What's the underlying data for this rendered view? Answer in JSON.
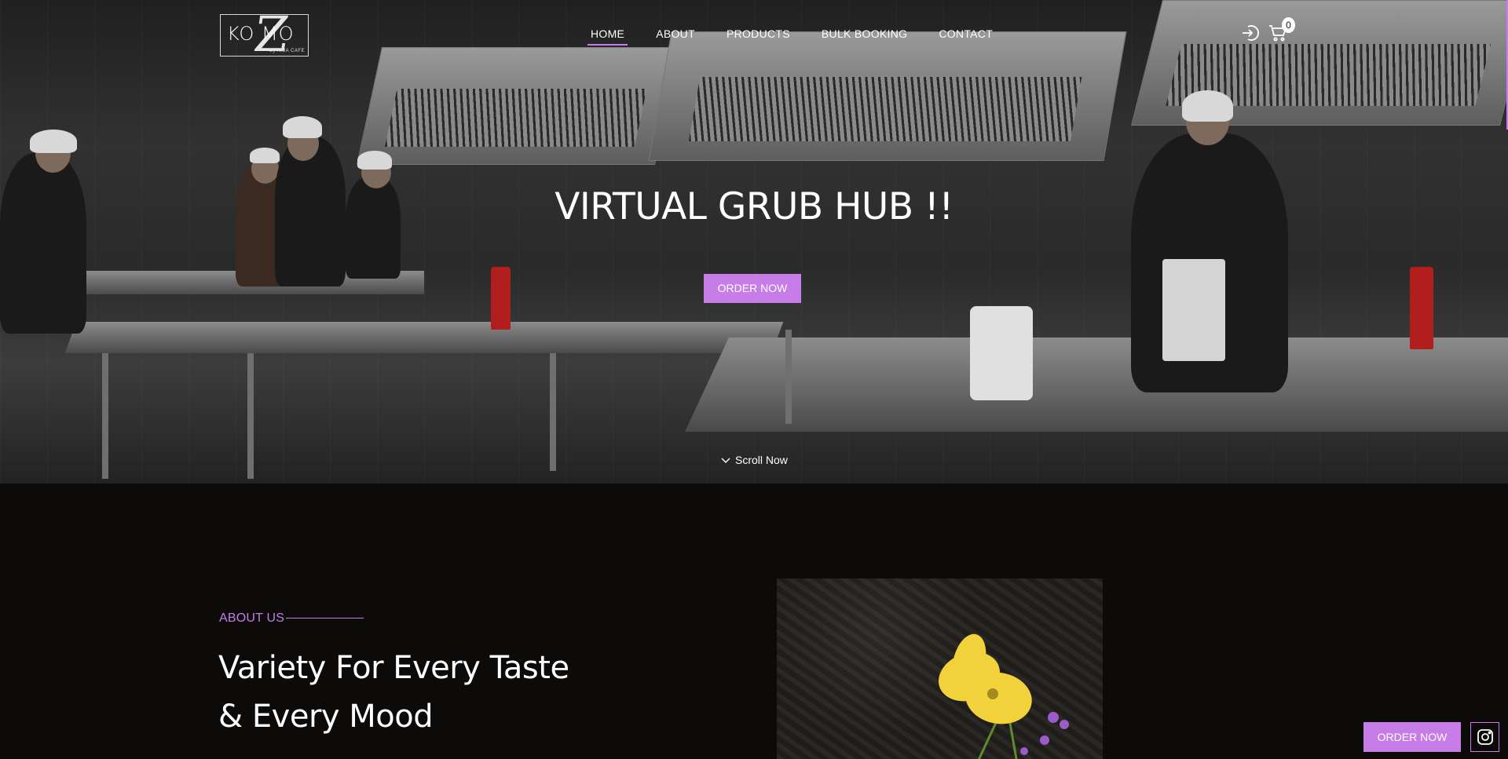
{
  "brand": {
    "logo_text": "KO MO",
    "logo_z": "Z",
    "logo_sub": "By NIJA CAFE"
  },
  "nav": {
    "items": [
      {
        "label": "HOME",
        "active": true
      },
      {
        "label": "ABOUT",
        "active": false
      },
      {
        "label": "PRODUCTS",
        "active": false
      },
      {
        "label": "BULK BOOKING",
        "active": false
      },
      {
        "label": "CONTACT",
        "active": false
      }
    ],
    "cart_count": "0",
    "icons": {
      "login": "login-icon",
      "cart": "cart-icon"
    }
  },
  "hero": {
    "title": "VIRTUAL GRUB HUB !!",
    "cta": "ORDER NOW",
    "scroll_label": "Scroll Now"
  },
  "about": {
    "kicker": "ABOUT US",
    "title": "Variety For Every Taste & Every Mood"
  },
  "floating": {
    "order_label": "ORDER NOW",
    "social_icon": "instagram-icon"
  },
  "colors": {
    "accent": "#c77de8",
    "background": "#0d0b09"
  }
}
